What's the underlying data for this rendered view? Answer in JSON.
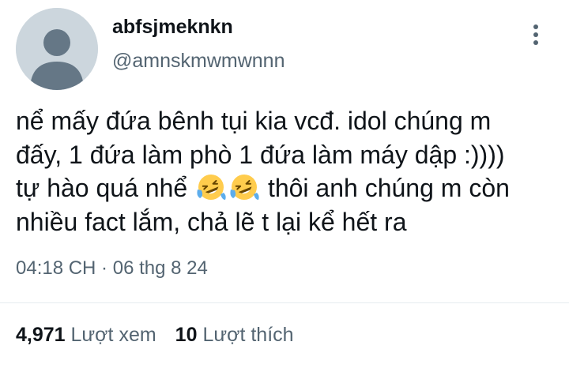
{
  "author": {
    "display_name": "abfsjmeknkn",
    "handle": "@amnskmwmwnnn"
  },
  "tweet": {
    "line1": "nể mấy đứa bênh tụi kia vcđ. idol chúng m",
    "line2": "đấy, 1 đứa làm phò 1 đứa làm máy dập :))))",
    "line3_before": "tự hào quá nhể",
    "line3_after": "thôi anh chúng m còn",
    "line4": "nhiều fact lắm, chả lẽ t lại kể hết ra",
    "emojis": [
      "rolling-on-floor-laughing-emoji",
      "rolling-on-floor-laughing-emoji"
    ]
  },
  "timestamp": "04:18 CH · 06 thg 8 24",
  "stats": {
    "views_count": "4,971",
    "views_label": "Lượt xem",
    "likes_count": "10",
    "likes_label": "Lượt thích"
  },
  "icons": {
    "more": "more-vertical-icon",
    "avatar": "default-avatar-icon"
  },
  "colors": {
    "text_primary": "#0f1419",
    "text_secondary": "#536471",
    "avatar_bg": "#ccd6dd",
    "avatar_fg": "#657786",
    "divider": "#e6ecf0",
    "emoji_face": "#ffcc4d",
    "emoji_tears": "#5dadec"
  }
}
